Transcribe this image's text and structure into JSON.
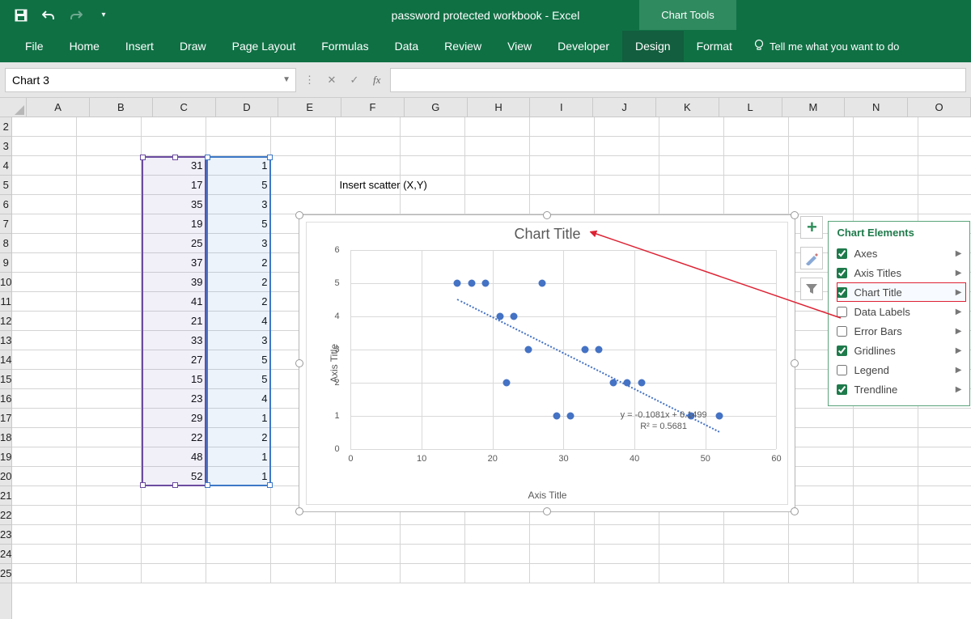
{
  "window": {
    "title": "password protected workbook  -  Excel",
    "context_tab": "Chart Tools"
  },
  "ribbon": {
    "tabs": [
      "File",
      "Home",
      "Insert",
      "Draw",
      "Page Layout",
      "Formulas",
      "Data",
      "Review",
      "View",
      "Developer",
      "Design",
      "Format"
    ],
    "tellme": "Tell me what you want to do"
  },
  "formula_bar": {
    "name_box": "Chart 3",
    "fx": "fx"
  },
  "columns": [
    "A",
    "B",
    "C",
    "D",
    "E",
    "F",
    "G",
    "H",
    "I",
    "J",
    "K",
    "L",
    "M",
    "N",
    "O"
  ],
  "rows": [
    2,
    3,
    4,
    5,
    6,
    7,
    8,
    9,
    10,
    11,
    12,
    13,
    14,
    15,
    16,
    17,
    18,
    19,
    20,
    21,
    22,
    23,
    24,
    25
  ],
  "sheet": {
    "f5": "Insert scatter (X,Y)",
    "colC": [
      31,
      17,
      35,
      19,
      25,
      37,
      39,
      41,
      21,
      33,
      27,
      15,
      23,
      29,
      22,
      48,
      52
    ],
    "colD": [
      1,
      5,
      3,
      5,
      3,
      2,
      2,
      2,
      4,
      3,
      5,
      5,
      4,
      1,
      2,
      1,
      1
    ]
  },
  "chart": {
    "title": "Chart Title",
    "xaxis": "Axis Title",
    "yaxis": "Axis Title",
    "equation": "y = -0.1081x + 6.1499",
    "r2": "R² = 0.5681"
  },
  "chart_data": {
    "type": "scatter",
    "x": [
      31,
      17,
      35,
      19,
      25,
      37,
      39,
      41,
      21,
      33,
      27,
      15,
      23,
      29,
      22,
      48,
      52
    ],
    "y": [
      1,
      5,
      3,
      5,
      3,
      2,
      2,
      2,
      4,
      3,
      5,
      5,
      4,
      1,
      2,
      1,
      1
    ],
    "xlabel": "Axis Title",
    "ylabel": "Axis Title",
    "title": "Chart Title",
    "xlim": [
      0,
      60
    ],
    "ylim": [
      0,
      6
    ],
    "xticks": [
      0,
      10,
      20,
      30,
      40,
      50,
      60
    ],
    "yticks": [
      0,
      1,
      2,
      3,
      4,
      5,
      6
    ],
    "trendline": {
      "slope": -0.1081,
      "intercept": 6.1499,
      "r2": 0.5681
    }
  },
  "elements_panel": {
    "title": "Chart Elements",
    "items": [
      {
        "label": "Axes",
        "checked": true
      },
      {
        "label": "Axis Titles",
        "checked": true
      },
      {
        "label": "Chart Title",
        "checked": true,
        "highlight": true
      },
      {
        "label": "Data Labels",
        "checked": false
      },
      {
        "label": "Error Bars",
        "checked": false
      },
      {
        "label": "Gridlines",
        "checked": true
      },
      {
        "label": "Legend",
        "checked": false
      },
      {
        "label": "Trendline",
        "checked": true
      }
    ]
  }
}
